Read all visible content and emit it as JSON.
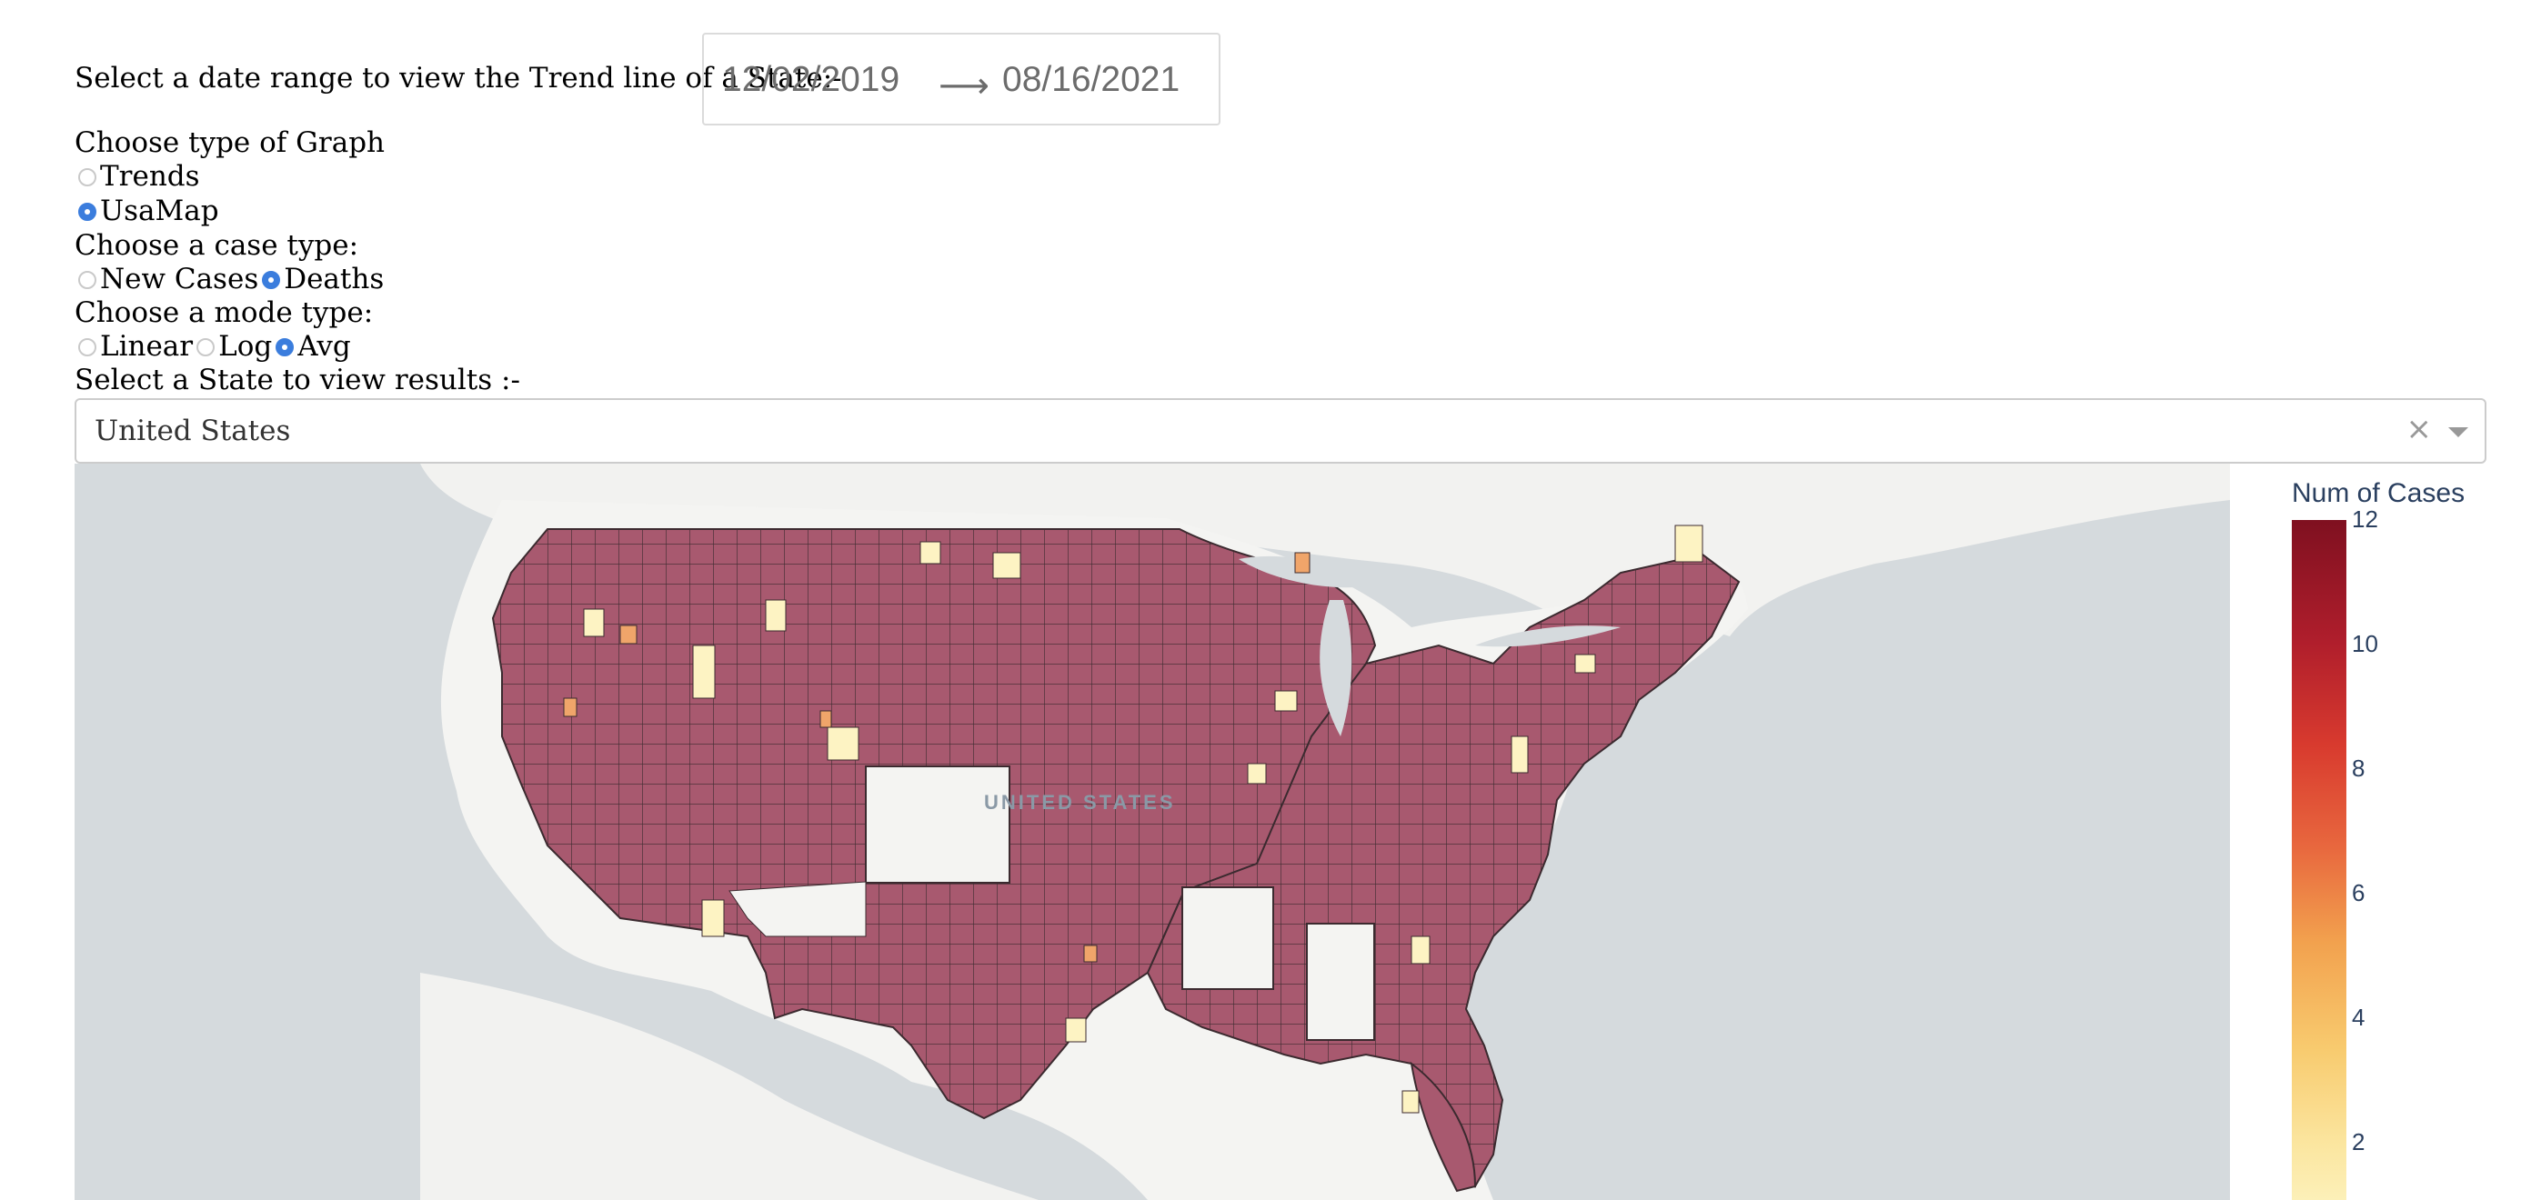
{
  "date_range": {
    "label": "Select a date range to view the Trend line of a State:-",
    "start": "12/02/2019",
    "arrow": "⟶",
    "end": "08/16/2021"
  },
  "graph_type": {
    "label": "Choose type of Graph",
    "options": [
      {
        "label": "Trends",
        "selected": false
      },
      {
        "label": "UsaMap",
        "selected": true
      }
    ]
  },
  "case_type": {
    "label": "Choose a case type:",
    "options": [
      {
        "label": "New Cases",
        "selected": false
      },
      {
        "label": "Deaths",
        "selected": true
      }
    ]
  },
  "mode_type": {
    "label": "Choose a mode type:",
    "options": [
      {
        "label": "Linear",
        "selected": false
      },
      {
        "label": "Log",
        "selected": false
      },
      {
        "label": "Avg",
        "selected": true
      }
    ]
  },
  "state_select": {
    "label": "Select a State to view results :-",
    "value": "United States",
    "clear_icon": "×"
  },
  "map": {
    "country_label": "UNITED STATES",
    "colors": {
      "water": "#d5dadd",
      "land": "#f2f2f0",
      "county_fill": "#a8596f",
      "low_fill": "#fdf3c3",
      "outline": "#3b2a2f"
    }
  },
  "colorbar": {
    "title": "Num of Cases",
    "ticks": [
      "12",
      "10",
      "8",
      "6",
      "4",
      "2"
    ]
  }
}
